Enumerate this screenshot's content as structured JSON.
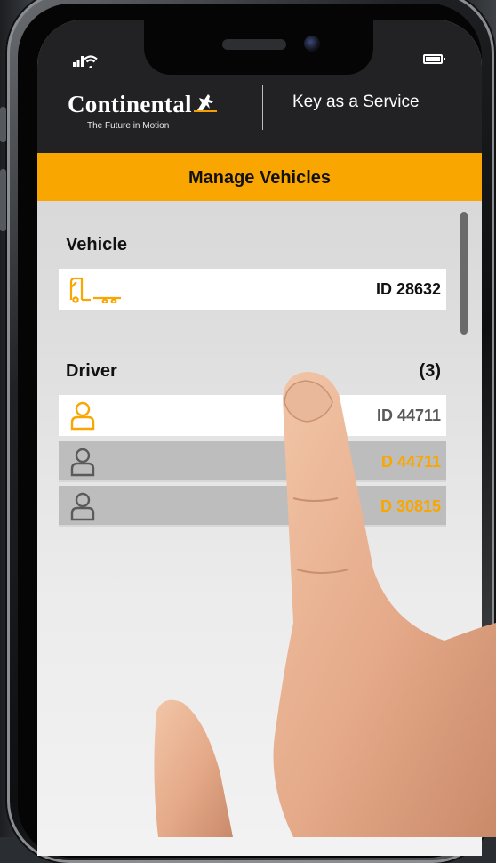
{
  "app": {
    "brand": "Continental",
    "tagline": "The Future in Motion",
    "service_title": "Key as a Service",
    "accent_color": "#f9a600",
    "header_color": "#222224"
  },
  "page": {
    "title": "Manage Vehicles"
  },
  "vehicle_section": {
    "label": "Vehicle",
    "items": [
      {
        "id_label": "ID 28632",
        "icon": "truck-trailer-icon"
      }
    ]
  },
  "driver_section": {
    "label": "Driver",
    "count": "(3)",
    "items": [
      {
        "id_label": "ID 44711",
        "icon": "person-icon",
        "state": "active"
      },
      {
        "id_label": "D 44711",
        "icon": "person-icon",
        "state": "inactive"
      },
      {
        "id_label": "D 30815",
        "icon": "person-icon",
        "state": "inactive"
      }
    ]
  }
}
